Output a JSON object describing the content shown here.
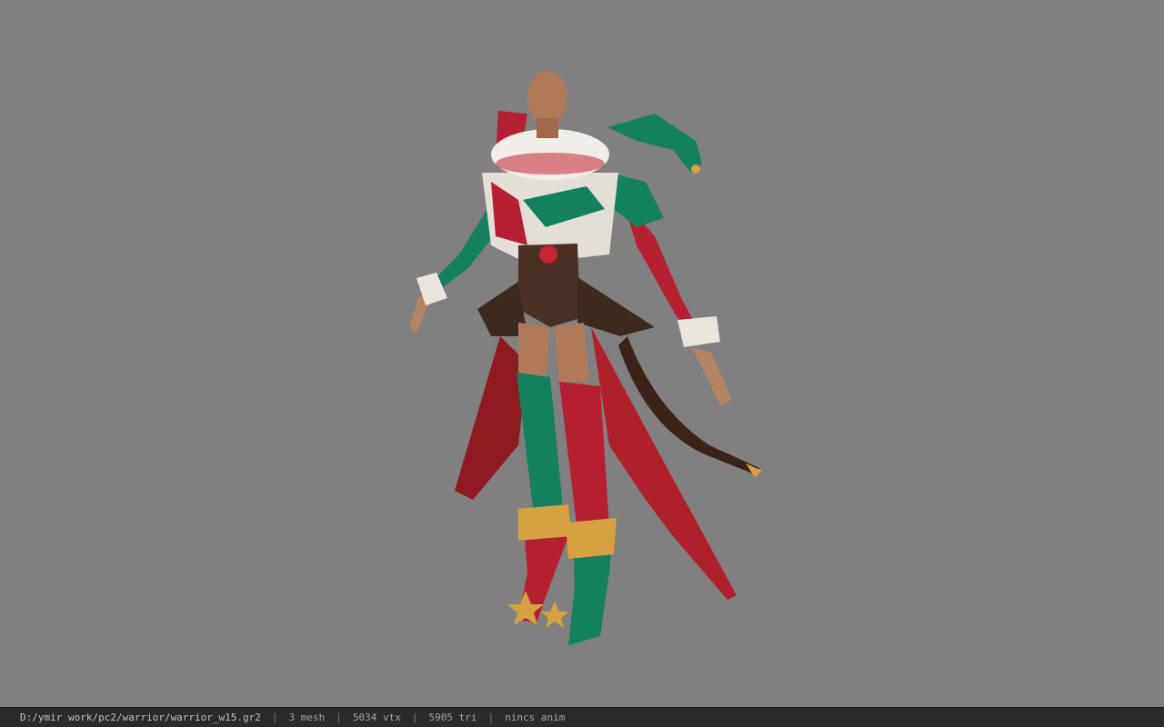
{
  "viewer": {
    "background_color": "#808080",
    "model_icon": "jester-character-model"
  },
  "statusbar": {
    "file_path": "D:/ymir work/pc2/warrior/warrior_w15.gr2",
    "separator": "|",
    "mesh_count": "3 mesh",
    "vertex_count": "5034 vtx",
    "triangle_count": "5905 tri",
    "anim_status": "nincs anim"
  }
}
